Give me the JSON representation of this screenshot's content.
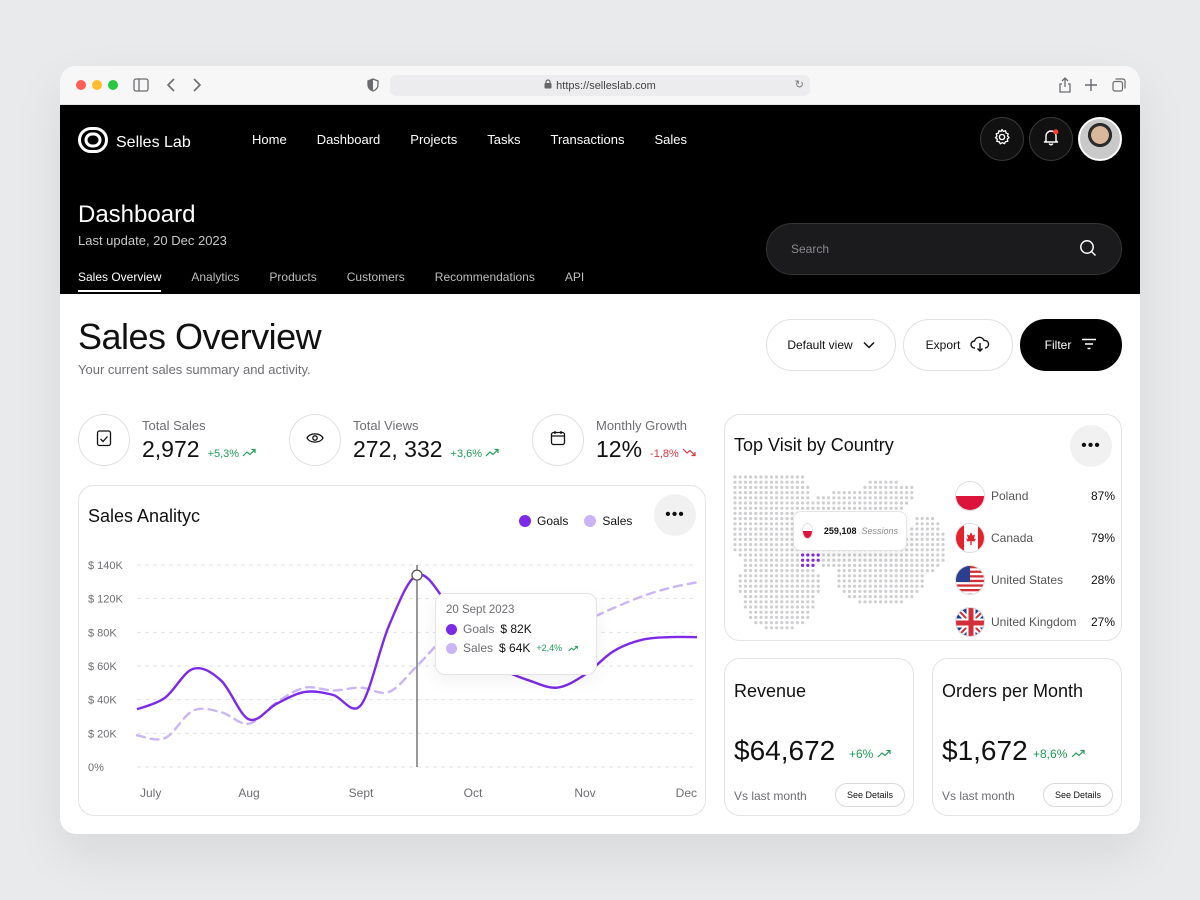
{
  "browser": {
    "url": "https://selleslab.com"
  },
  "header": {
    "brand": "Selles Lab",
    "nav": [
      "Home",
      "Dashboard",
      "Projects",
      "Tasks",
      "Transactions",
      "Sales"
    ],
    "title": "Dashboard",
    "subtitle": "Last update, 20 Dec 2023",
    "search_placeholder": "Search",
    "tabs": [
      "Sales Overview",
      "Analytics",
      "Products",
      "Customers",
      "Recommendations",
      "API"
    ],
    "active_tab": "Sales Overview"
  },
  "main": {
    "title": "Sales Overview",
    "subtitle": "Your current sales summary and activity.",
    "actions": {
      "view": "Default view",
      "export": "Export",
      "filter": "Filter"
    }
  },
  "stats": [
    {
      "label": "Total Sales",
      "value": "2,972",
      "change": "+5,3%",
      "trend": "up"
    },
    {
      "label": "Total Views",
      "value": "272, 332",
      "change": "+3,6%",
      "trend": "up"
    },
    {
      "label": "Monthly Growth",
      "value": "12%",
      "change": "-1,8%",
      "trend": "down"
    }
  ],
  "colors": {
    "goals": "#7c2ae8",
    "sales": "#cbb5f6",
    "positive": "#1f9d55",
    "negative": "#d9363e"
  },
  "analytics": {
    "title": "Sales Analityc",
    "legend": [
      "Goals",
      "Sales"
    ],
    "tooltip": {
      "date": "20 Sept 2023",
      "goals_label": "Goals",
      "goals_value": "$ 82K",
      "sales_label": "Sales",
      "sales_value": "$ 64K",
      "sales_change": "+2,4%"
    }
  },
  "chart_data": {
    "type": "line",
    "x": [
      0,
      0.25,
      0.5,
      0.75,
      1,
      1.25,
      1.5,
      1.75,
      2,
      2.25,
      2.5,
      2.75,
      3,
      3.25,
      3.5,
      3.75,
      4,
      4.25,
      4.5,
      4.75,
      5
    ],
    "x_ticks": [
      "July",
      "Aug",
      "Sept",
      "Oct",
      "Nov",
      "Dec"
    ],
    "y_ticks": [
      "$ 140K",
      "$ 120K",
      "$ 80K",
      "$ 60K",
      "$ 40K",
      "$ 20K",
      "0%"
    ],
    "ylim": [
      0,
      140
    ],
    "series": [
      {
        "name": "Goals",
        "values": [
          40,
          48,
          68,
          60,
          33,
          44,
          52,
          50,
          43,
          98,
          133,
          115,
          80,
          68,
          60,
          55,
          64,
          80,
          88,
          90,
          90
        ]
      },
      {
        "name": "Sales",
        "values": [
          22,
          20,
          39,
          38,
          30,
          45,
          55,
          53,
          55,
          52,
          70,
          90,
          102,
          100,
          85,
          100,
          102,
          110,
          118,
          124,
          128
        ]
      }
    ],
    "highlight": {
      "x": 2.5,
      "label": "20 Sept 2023"
    },
    "grid": true
  },
  "countries": {
    "title": "Top Visit by Country",
    "sessions": "259,108",
    "sessions_label": "Sessions",
    "items": [
      {
        "name": "Poland",
        "pct": "87%"
      },
      {
        "name": "Canada",
        "pct": "79%"
      },
      {
        "name": "United States",
        "pct": "28%"
      },
      {
        "name": "United Kingdom",
        "pct": "27%"
      }
    ]
  },
  "revenue": {
    "title": "Revenue",
    "value": "$64,672",
    "change": "+6%",
    "vs": "Vs last month",
    "details": "See Details"
  },
  "orders": {
    "title": "Orders per Month",
    "value": "$1,672",
    "change": "+8,6%",
    "vs": "Vs last month",
    "details": "See Details"
  }
}
